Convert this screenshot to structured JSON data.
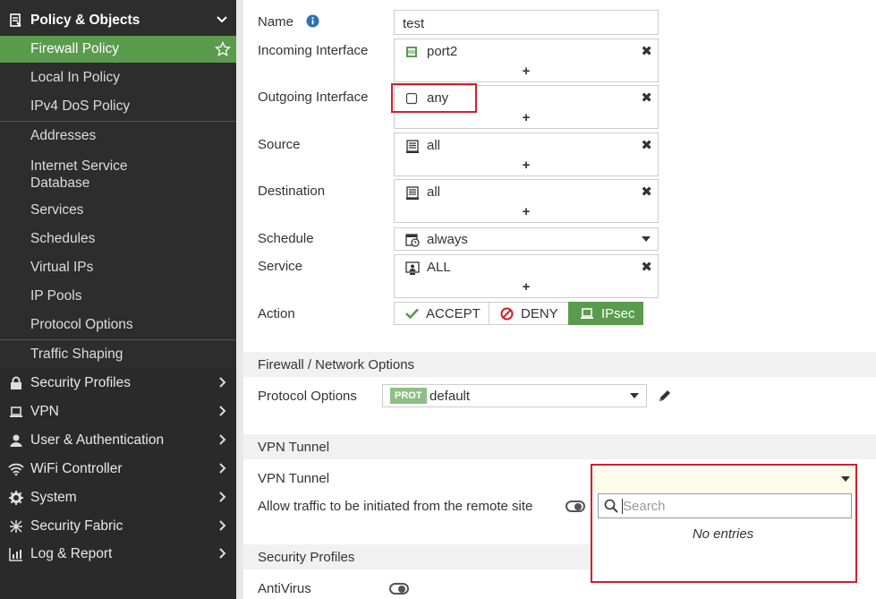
{
  "sidebar": {
    "header": "Policy & Objects",
    "items": [
      {
        "label": "Firewall Policy"
      },
      {
        "label": "Local In Policy"
      },
      {
        "label": "IPv4 DoS Policy"
      },
      {
        "label": "Addresses"
      },
      {
        "label": "Internet Service"
      },
      {
        "label": "Database"
      },
      {
        "label": "Services"
      },
      {
        "label": "Schedules"
      },
      {
        "label": "Virtual IPs"
      },
      {
        "label": "IP Pools"
      },
      {
        "label": "Protocol Options"
      },
      {
        "label": "Traffic Shaping"
      }
    ],
    "top_items": [
      {
        "label": "Security Profiles"
      },
      {
        "label": "VPN"
      },
      {
        "label": "User & Authentication"
      },
      {
        "label": "WiFi Controller"
      },
      {
        "label": "System"
      },
      {
        "label": "Security Fabric"
      },
      {
        "label": "Log & Report"
      }
    ]
  },
  "form": {
    "name_label": "Name",
    "name_value": "test",
    "incoming_label": "Incoming Interface",
    "incoming_value": "port2",
    "outgoing_label": "Outgoing Interface",
    "outgoing_value": "any",
    "source_label": "Source",
    "source_value": "all",
    "destination_label": "Destination",
    "destination_value": "all",
    "schedule_label": "Schedule",
    "schedule_value": "always",
    "service_label": "Service",
    "service_value": "ALL",
    "action_label": "Action",
    "action_accept": "ACCEPT",
    "action_deny": "DENY",
    "action_ipsec": "IPsec",
    "plus": "+",
    "remove": "✖"
  },
  "sections": {
    "firewall": "Firewall / Network Options",
    "vpn": "VPN Tunnel",
    "security": "Security Profiles"
  },
  "firewall_options": {
    "protocol_label": "Protocol Options",
    "prot_badge": "PROT",
    "protocol_value": "default"
  },
  "vpn": {
    "tunnel_label": "VPN Tunnel",
    "allow_label": "Allow traffic to be initiated from the remote site",
    "search_placeholder": "Search",
    "no_entries": "No entries"
  },
  "security": {
    "antivirus_label": "AntiVirus"
  },
  "colors": {
    "accent_green": "#5a9b4d",
    "highlight_red": "#d0202d",
    "sidebar_bg": "#2d2d2d"
  }
}
